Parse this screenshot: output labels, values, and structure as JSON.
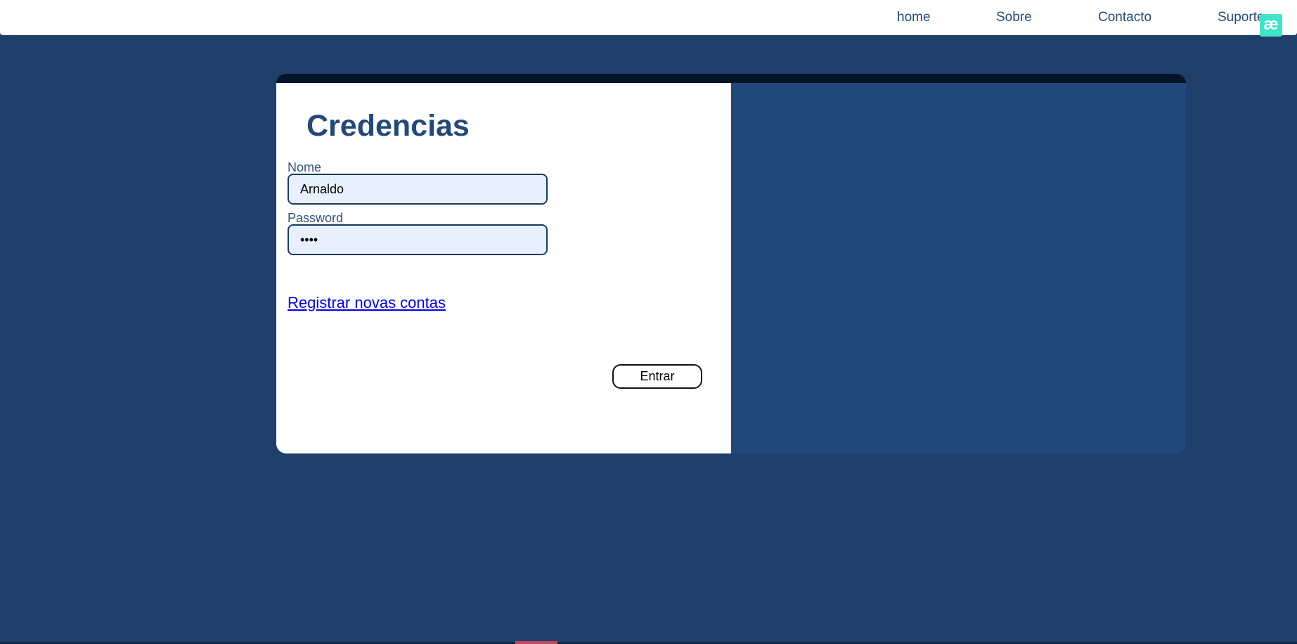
{
  "nav": {
    "items": [
      {
        "label": "home"
      },
      {
        "label": "Sobre"
      },
      {
        "label": "Contacto"
      },
      {
        "label": "Suporte"
      }
    ],
    "extension_badge": "æ"
  },
  "login": {
    "title": "Credencias",
    "name_label": "Nome",
    "name_value": "Arnaldo",
    "password_label": "Password",
    "password_value": "1234",
    "register_link": "Registrar novas contas",
    "submit_label": "Entrar"
  },
  "colors": {
    "page_background": "#1f3f6a",
    "accent": "#22497a",
    "card_topbar": "#06142a",
    "badge": "#3ee4c9",
    "link": "#0000ee"
  }
}
